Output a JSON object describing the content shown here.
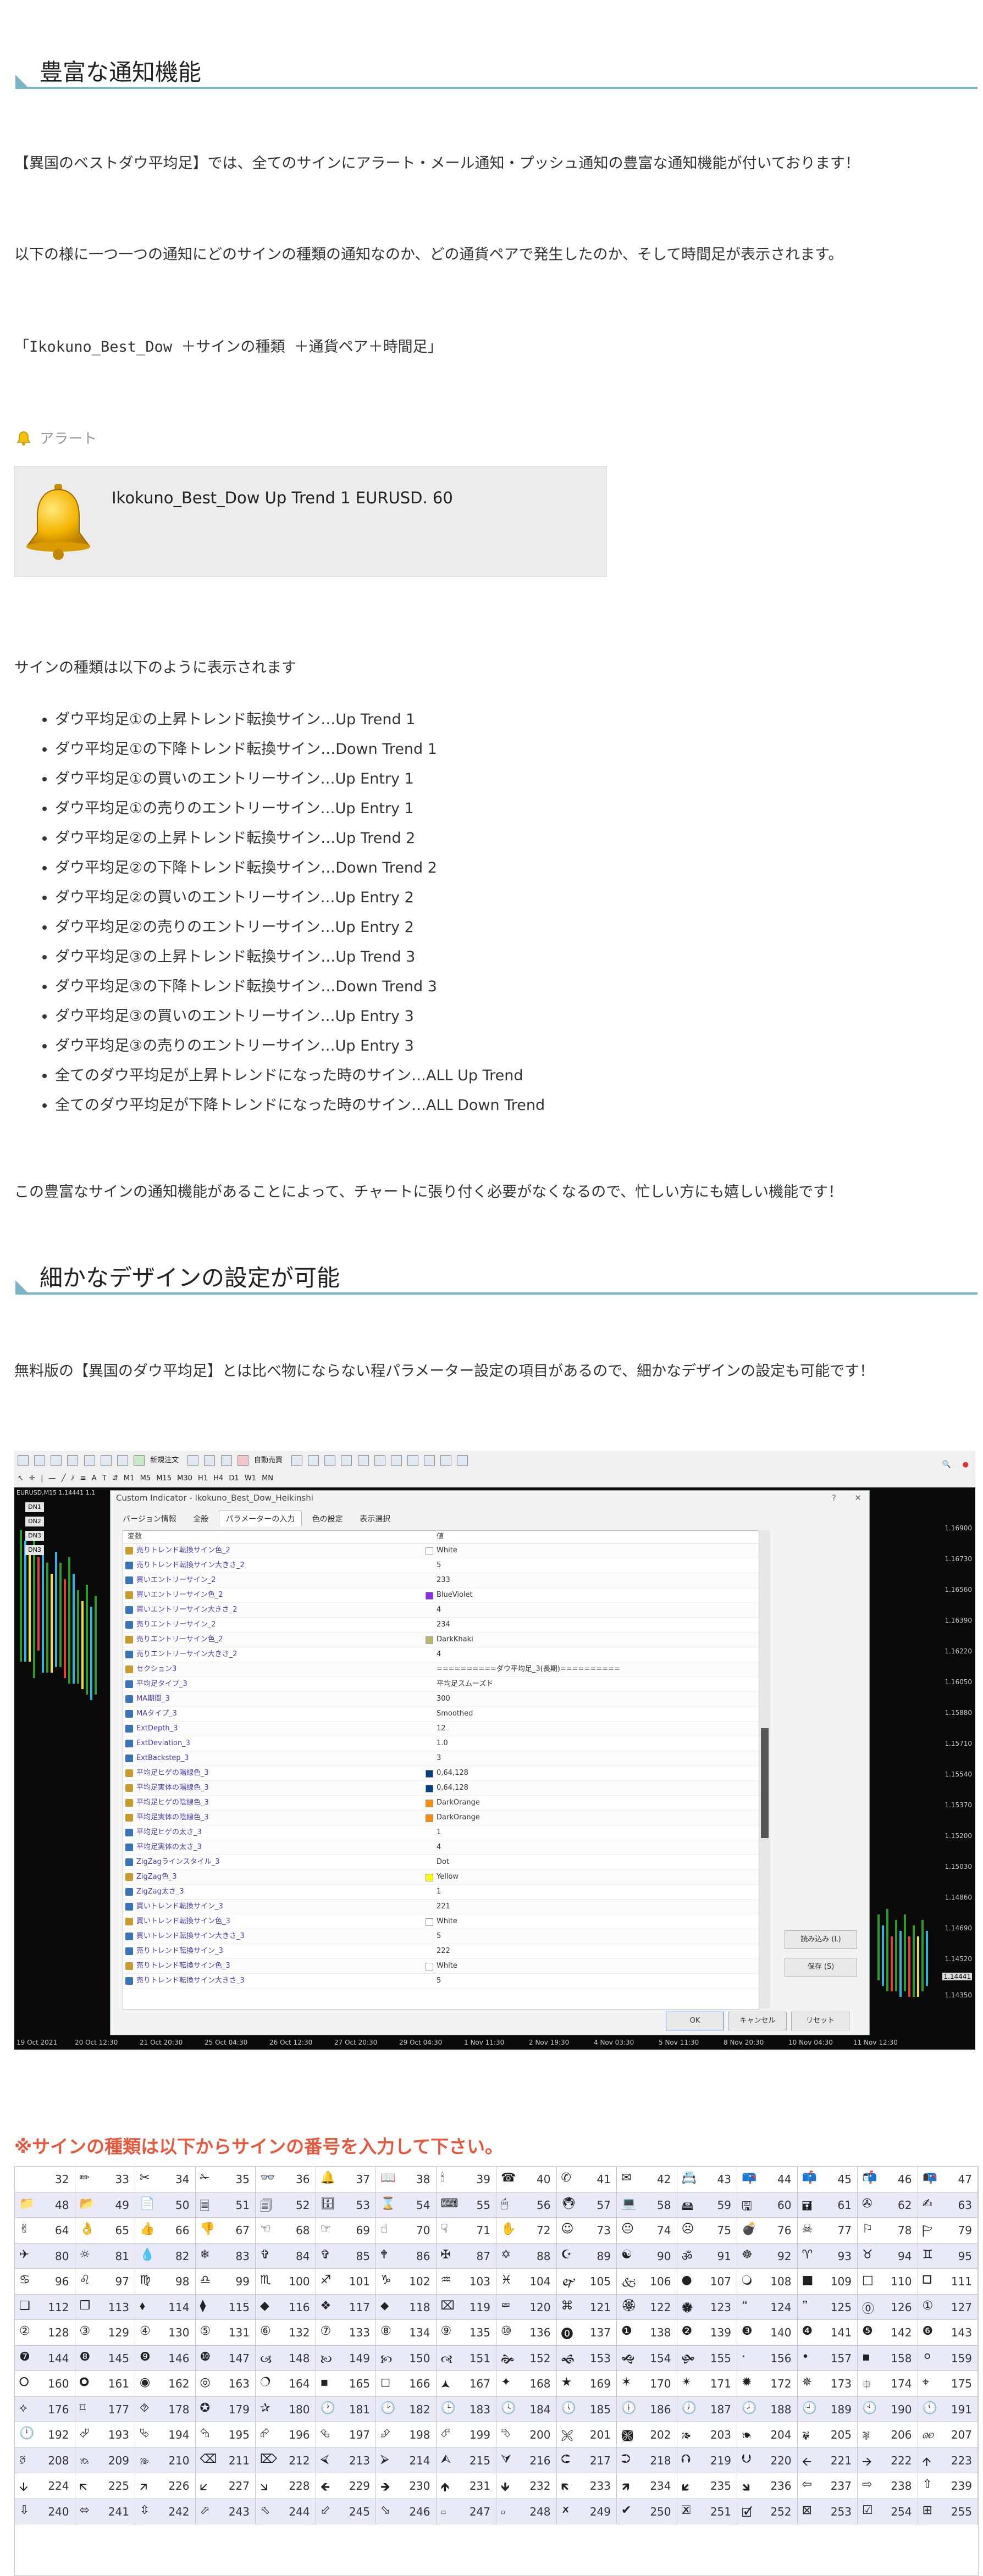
{
  "section1": {
    "heading": "豊富な通知機能",
    "intro": "【異国のベストダウ平均足】では、全てのサインにアラート・メール通知・プッシュ通知の豊富な通知機能が付いております！",
    "explain": "以下の様に一つ一つの通知にどのサインの種類の通知なのか、どの通貨ペアで発生したのか、そして時間足が表示されます。",
    "format": "「Ikokuno_Best_Dow ＋サインの種類 ＋通貨ペア＋時間足」",
    "alert_label": "アラート",
    "alert_message": "Ikokuno_Best_Dow Up Trend 1 EURUSD. 60",
    "sign_types_intro": "サインの種類は以下のように表示されます",
    "sign_types": [
      "ダウ平均足①の上昇トレンド転換サイン…Up Trend 1",
      "ダウ平均足①の下降トレンド転換サイン…Down Trend 1",
      "ダウ平均足①の買いのエントリーサイン…Up Entry 1",
      "ダウ平均足①の売りのエントリーサイン…Up Entry 1",
      "ダウ平均足②の上昇トレンド転換サイン…Up Trend 2",
      "ダウ平均足②の下降トレンド転換サイン…Down Trend 2",
      "ダウ平均足②の買いのエントリーサイン…Up Entry 2",
      "ダウ平均足②の売りのエントリーサイン…Up Entry 2",
      "ダウ平均足③の上昇トレンド転換サイン…Up Trend 3",
      "ダウ平均足③の下降トレンド転換サイン…Down Trend 3",
      "ダウ平均足③の買いのエントリーサイン…Up Entry 3",
      "ダウ平均足③の売りのエントリーサイン…Up Entry 3",
      "全てのダウ平均足が上昇トレンドになった時のサイン…ALL Up Trend",
      "全てのダウ平均足が下降トレンドになった時のサイン…ALL Down Trend"
    ],
    "closing": "この豊富なサインの通知機能があることによって、チャートに張り付く必要がなくなるので、忙しい方にも嬉しい機能です！"
  },
  "section2": {
    "heading": "細かなデザインの設定が可能",
    "intro": "無料版の【異国のダウ平均足】とは比べ物にならない程パラメーター設定の項目があるので、細かなデザインの設定も可能です！"
  },
  "terminal": {
    "toolbar_labels": [
      "新規注文",
      "自動売買"
    ],
    "timeframes": [
      "M1",
      "M5",
      "M15",
      "M30",
      "H1",
      "H4",
      "D1",
      "W1",
      "MN"
    ],
    "chart_title": "EURUSD,M15 1.14441 1.1",
    "tags": [
      "DN1",
      "DN2",
      "DN3",
      "DN3"
    ],
    "price_labels": [
      "1.16900",
      "1.16730",
      "1.16560",
      "1.16390",
      "1.16220",
      "1.16050",
      "1.15880",
      "1.15710",
      "1.15540",
      "1.15370",
      "1.15200",
      "1.15030",
      "1.14860",
      "1.14690",
      "1.14520",
      "1.14441",
      "1.14350"
    ],
    "time_labels": [
      "19 Oct 2021",
      "20 Oct 12:30",
      "21 Oct 20:30",
      "25 Oct 04:30",
      "26 Oct 12:30",
      "27 Oct 20:30",
      "29 Oct 04:30",
      "1 Nov 11:30",
      "2 Nov 19:30",
      "4 Nov 03:30",
      "5 Nov 11:30",
      "8 Nov 20:30",
      "10 Nov 04:30",
      "11 Nov 12:30"
    ],
    "dialog": {
      "title": "Custom Indicator - Ikokuno_Best_Dow_Heikinshi",
      "help": "?",
      "close": "✕",
      "tabs": [
        "バージョン情報",
        "全般",
        "パラメーターの入力",
        "色の設定",
        "表示選択"
      ],
      "col_variable": "変数",
      "col_value": "値",
      "params": [
        {
          "name": "売りトレンド転換サイン色_2",
          "value": "White",
          "swatch": "#ffffff",
          "icon": "#c99a2e"
        },
        {
          "name": "売りトレンド転換サイン大きさ_2",
          "value": "5",
          "icon": "#3a73b8"
        },
        {
          "name": "買いエントリーサイン_2",
          "value": "233",
          "icon": "#3a73b8"
        },
        {
          "name": "買いエントリーサイン色_2",
          "value": "BlueViolet",
          "swatch": "#8a2be2",
          "icon": "#c99a2e"
        },
        {
          "name": "買いエントリーサイン大きさ_2",
          "value": "4",
          "icon": "#3a73b8"
        },
        {
          "name": "売りエントリーサイン_2",
          "value": "234",
          "icon": "#3a73b8"
        },
        {
          "name": "売りエントリーサイン色_2",
          "value": "DarkKhaki",
          "swatch": "#bdb76b",
          "icon": "#c99a2e"
        },
        {
          "name": "売りエントリーサイン大きさ_2",
          "value": "4",
          "icon": "#3a73b8"
        },
        {
          "name": "セクション3",
          "value": "==========ダウ平均足_3(長期)==========",
          "icon": "#c99a2e"
        },
        {
          "name": "平均足タイプ_3",
          "value": "平均足スムーズド",
          "icon": "#3a73b8"
        },
        {
          "name": "MA期間_3",
          "value": "300",
          "icon": "#3a73b8"
        },
        {
          "name": "MAタイプ_3",
          "value": "Smoothed",
          "icon": "#3a73b8"
        },
        {
          "name": "ExtDepth_3",
          "value": "12",
          "icon": "#3a73b8"
        },
        {
          "name": "ExtDeviation_3",
          "value": "1.0",
          "icon": "#3a73b8"
        },
        {
          "name": "ExtBackstep_3",
          "value": "3",
          "icon": "#3a73b8"
        },
        {
          "name": "平均足ヒゲの陽線色_3",
          "value": "0,64,128",
          "swatch": "#004080",
          "icon": "#c99a2e"
        },
        {
          "name": "平均足実体の陽線色_3",
          "value": "0,64,128",
          "swatch": "#004080",
          "icon": "#c99a2e"
        },
        {
          "name": "平均足ヒゲの陰線色_3",
          "value": "DarkOrange",
          "swatch": "#ff8c00",
          "icon": "#c99a2e"
        },
        {
          "name": "平均足実体の陰線色_3",
          "value": "DarkOrange",
          "swatch": "#ff8c00",
          "icon": "#c99a2e"
        },
        {
          "name": "平均足ヒゲの太さ_3",
          "value": "1",
          "icon": "#3a73b8"
        },
        {
          "name": "平均足実体の太さ_3",
          "value": "4",
          "icon": "#3a73b8"
        },
        {
          "name": "ZigZagラインスタイル_3",
          "value": "Dot",
          "icon": "#3a73b8"
        },
        {
          "name": "ZigZag色_3",
          "value": "Yellow",
          "swatch": "#ffff00",
          "icon": "#c99a2e"
        },
        {
          "name": "ZigZag太さ_3",
          "value": "1",
          "icon": "#3a73b8"
        },
        {
          "name": "買いトレンド転換サイン_3",
          "value": "221",
          "icon": "#3a73b8"
        },
        {
          "name": "買いトレンド転換サイン色_3",
          "value": "White",
          "swatch": "#ffffff",
          "icon": "#c99a2e"
        },
        {
          "name": "買いトレンド転換サイン大きさ_3",
          "value": "5",
          "icon": "#3a73b8"
        },
        {
          "name": "売りトレンド転換サイン_3",
          "value": "222",
          "icon": "#3a73b8"
        },
        {
          "name": "売りトレンド転換サイン色_3",
          "value": "White",
          "swatch": "#ffffff",
          "icon": "#c99a2e"
        },
        {
          "name": "売りトレンド転換サイン大きさ_3",
          "value": "5",
          "icon": "#3a73b8"
        }
      ],
      "load_button": "読み込み (L)",
      "save_button": "保存 (S)",
      "ok_button": "OK",
      "cancel_button": "キャンセル",
      "reset_button": "リセット"
    }
  },
  "symbols": {
    "heading": "※サインの種類は以下からサインの番号を入力して下さい。",
    "row_colors": {
      "alt": "#e9e9f8"
    },
    "cells": [
      [
        "",
        32
      ],
      [
        "✏",
        33
      ],
      [
        "✂",
        34
      ],
      [
        "✁",
        35
      ],
      [
        "👓",
        36
      ],
      [
        "🔔",
        37
      ],
      [
        "📖",
        38
      ],
      [
        "🕯",
        39
      ],
      [
        "☎",
        40
      ],
      [
        "✆",
        41
      ],
      [
        "✉",
        42
      ],
      [
        "📇",
        43
      ],
      [
        "📪",
        44
      ],
      [
        "📫",
        45
      ],
      [
        "📬",
        46
      ],
      [
        "📭",
        47
      ],
      [
        "📁",
        48
      ],
      [
        "📂",
        49
      ],
      [
        "📄",
        50
      ],
      [
        "🗏",
        51
      ],
      [
        "🗐",
        52
      ],
      [
        "🗄",
        53
      ],
      [
        "⌛",
        54
      ],
      [
        "⌨",
        55
      ],
      [
        "🖱",
        56
      ],
      [
        "🖲",
        57
      ],
      [
        "💻",
        58
      ],
      [
        "🖴",
        59
      ],
      [
        "🖫",
        60
      ],
      [
        "🖬",
        61
      ],
      [
        "✇",
        62
      ],
      [
        "✍",
        63
      ],
      [
        "✌",
        64
      ],
      [
        "👌",
        65
      ],
      [
        "👍",
        66
      ],
      [
        "👎",
        67
      ],
      [
        "☜",
        68
      ],
      [
        "☞",
        69
      ],
      [
        "☝",
        70
      ],
      [
        "☟",
        71
      ],
      [
        "✋",
        72
      ],
      [
        "☺",
        73
      ],
      [
        "😐",
        74
      ],
      [
        "☹",
        75
      ],
      [
        "💣",
        76
      ],
      [
        "☠",
        77
      ],
      [
        "⚐",
        78
      ],
      [
        "🏱",
        79
      ],
      [
        "✈",
        80
      ],
      [
        "☼",
        81
      ],
      [
        "💧",
        82
      ],
      [
        "❄",
        83
      ],
      [
        "✞",
        84
      ],
      [
        "✞",
        85
      ],
      [
        "🕈",
        86
      ],
      [
        "✠",
        87
      ],
      [
        "✡",
        88
      ],
      [
        "☪",
        89
      ],
      [
        "☯",
        90
      ],
      [
        "ॐ",
        91
      ],
      [
        "☸",
        92
      ],
      [
        "♈",
        93
      ],
      [
        "♉",
        94
      ],
      [
        "♊",
        95
      ],
      [
        "♋",
        96
      ],
      [
        "♌",
        97
      ],
      [
        "♍",
        98
      ],
      [
        "♎",
        99
      ],
      [
        "♏",
        100
      ],
      [
        "♐",
        101
      ],
      [
        "♑",
        102
      ],
      [
        "♒",
        103
      ],
      [
        "♓",
        104
      ],
      [
        "🙰",
        105
      ],
      [
        "🙵",
        106
      ],
      [
        "●",
        107
      ],
      [
        "🔾",
        108
      ],
      [
        "■",
        109
      ],
      [
        "□",
        110
      ],
      [
        "🞐",
        111
      ],
      [
        "❑",
        112
      ],
      [
        "❒",
        113
      ],
      [
        "⬧",
        114
      ],
      [
        "⧫",
        115
      ],
      [
        "◆",
        116
      ],
      [
        "❖",
        117
      ],
      [
        "⬥",
        118
      ],
      [
        "⌧",
        119
      ],
      [
        "⮹",
        120
      ],
      [
        "⌘",
        121
      ],
      [
        "🏵",
        122
      ],
      [
        "🏶",
        123
      ],
      [
        "🙶",
        124
      ],
      [
        "🙷",
        125
      ],
      [
        "⓪",
        126
      ],
      [
        "①",
        127
      ],
      [
        "②",
        128
      ],
      [
        "③",
        129
      ],
      [
        "④",
        130
      ],
      [
        "⑤",
        131
      ],
      [
        "⑥",
        132
      ],
      [
        "⑦",
        133
      ],
      [
        "⑧",
        134
      ],
      [
        "⑨",
        135
      ],
      [
        "⑩",
        136
      ],
      [
        "⓿",
        137
      ],
      [
        "❶",
        138
      ],
      [
        "❷",
        139
      ],
      [
        "❸",
        140
      ],
      [
        "❹",
        141
      ],
      [
        "❺",
        142
      ],
      [
        "❻",
        143
      ],
      [
        "❼",
        144
      ],
      [
        "❽",
        145
      ],
      [
        "❾",
        146
      ],
      [
        "❿",
        147
      ],
      [
        "🙢",
        148
      ],
      [
        "🙠",
        149
      ],
      [
        "🙡",
        150
      ],
      [
        "🙣",
        151
      ],
      [
        "🙞",
        152
      ],
      [
        "🙜",
        153
      ],
      [
        "🙝",
        154
      ],
      [
        "🙟",
        155
      ],
      [
        "·",
        156
      ],
      [
        "•",
        157
      ],
      [
        "▪",
        158
      ],
      [
        "⚪",
        159
      ],
      [
        "🞆",
        160
      ],
      [
        "🞈",
        161
      ],
      [
        "◉",
        162
      ],
      [
        "◎",
        163
      ],
      [
        "🔿",
        164
      ],
      [
        "▪",
        165
      ],
      [
        "◻",
        166
      ],
      [
        "🟂",
        167
      ],
      [
        "✦",
        168
      ],
      [
        "★",
        169
      ],
      [
        "✶",
        170
      ],
      [
        "✴",
        171
      ],
      [
        "✹",
        172
      ],
      [
        "✵",
        173
      ],
      [
        "⯐",
        174
      ],
      [
        "⌖",
        175
      ],
      [
        "⟡",
        176
      ],
      [
        "⌑",
        177
      ],
      [
        "⯑",
        178
      ],
      [
        "✪",
        179
      ],
      [
        "✰",
        180
      ],
      [
        "🕐",
        181
      ],
      [
        "🕑",
        182
      ],
      [
        "🕒",
        183
      ],
      [
        "🕓",
        184
      ],
      [
        "🕔",
        185
      ],
      [
        "🕕",
        186
      ],
      [
        "🕖",
        187
      ],
      [
        "🕗",
        188
      ],
      [
        "🕘",
        189
      ],
      [
        "🕙",
        190
      ],
      [
        "🕚",
        191
      ],
      [
        "🕛",
        192
      ],
      [
        "⮰",
        193
      ],
      [
        "⮱",
        194
      ],
      [
        "⮲",
        195
      ],
      [
        "⮳",
        196
      ],
      [
        "⮴",
        197
      ],
      [
        "⮵",
        198
      ],
      [
        "⮶",
        199
      ],
      [
        "⮷",
        200
      ],
      [
        "🙪",
        201
      ],
      [
        "🙫",
        202
      ],
      [
        "🙕",
        203
      ],
      [
        "🙔",
        204
      ],
      [
        "🙗",
        205
      ],
      [
        "🙖",
        206
      ],
      [
        "🙐",
        207
      ],
      [
        "🙑",
        208
      ],
      [
        "🙒",
        209
      ],
      [
        "🙓",
        210
      ],
      [
        "⌫",
        211
      ],
      [
        "⌦",
        212
      ],
      [
        "⮘",
        213
      ],
      [
        "⮚",
        214
      ],
      [
        "⮙",
        215
      ],
      [
        "⮛",
        216
      ],
      [
        "⮈",
        217
      ],
      [
        "⮊",
        218
      ],
      [
        "⮉",
        219
      ],
      [
        "⮋",
        220
      ],
      [
        "🡨",
        221
      ],
      [
        "🡪",
        222
      ],
      [
        "🡩",
        223
      ],
      [
        "🡫",
        224
      ],
      [
        "🡬",
        225
      ],
      [
        "🡭",
        226
      ],
      [
        "🡯",
        227
      ],
      [
        "🡮",
        228
      ],
      [
        "🡸",
        229
      ],
      [
        "🡺",
        230
      ],
      [
        "🡹",
        231
      ],
      [
        "🡻",
        232
      ],
      [
        "🡼",
        233
      ],
      [
        "🡽",
        234
      ],
      [
        "🡿",
        235
      ],
      [
        "🡾",
        236
      ],
      [
        "⇦",
        237
      ],
      [
        "⇨",
        238
      ],
      [
        "⇧",
        239
      ],
      [
        "⇩",
        240
      ],
      [
        "⬄",
        241
      ],
      [
        "⇳",
        242
      ],
      [
        "⬀",
        243
      ],
      [
        "⬁",
        244
      ],
      [
        "⬃",
        245
      ],
      [
        "⬂",
        246
      ],
      [
        "🢬",
        247
      ],
      [
        "🢭",
        248
      ],
      [
        "🗶",
        249
      ],
      [
        "✔",
        250
      ],
      [
        "🗷",
        251
      ],
      [
        "🗹",
        252
      ],
      [
        "⊠",
        253
      ],
      [
        "☑",
        254
      ],
      [
        "⊞",
        255
      ]
    ]
  }
}
